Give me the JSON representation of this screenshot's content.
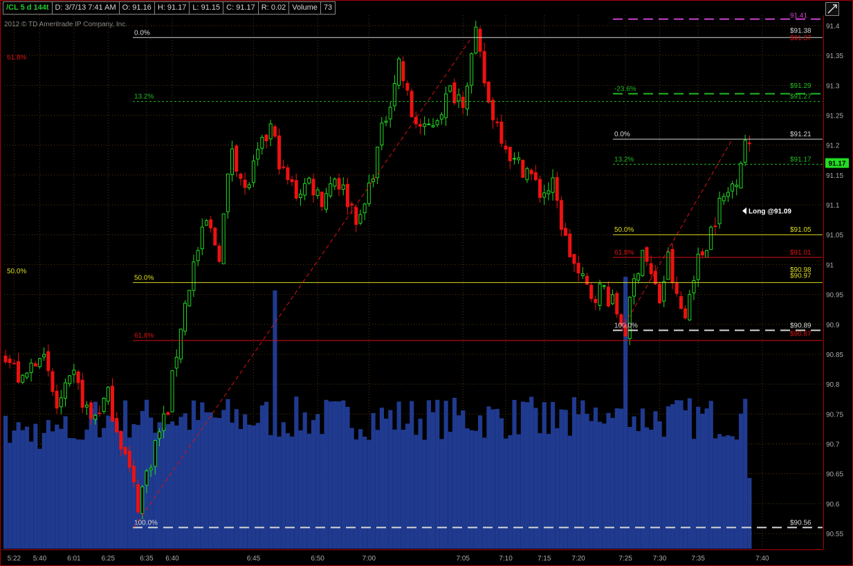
{
  "header": {
    "symbol": "/CL 5 d 144t",
    "datetime": "D: 3/7/13 7:41 AM",
    "open": "O: 91.16",
    "high": "H: 91.17",
    "low": "L: 91.15",
    "close": "C: 91.17",
    "range": "R: 0.02",
    "volume_label": "Volume",
    "volume_value": "73"
  },
  "copyright": "2012 © TD Ameritrade IP Company, Inc.",
  "colors": {
    "background": "#000000",
    "grid": "#5a3a10",
    "bull": "#22dd22",
    "bear": "#ee1111",
    "volume": "#1f3a8f",
    "fib_white": "#d8d8d8",
    "fib_green": "#22bb22",
    "fib_yellow": "#dddd22",
    "fib_red": "#dd1111",
    "fib_magenta": "#cc44cc",
    "axis_text": "#aaaaaa",
    "frame": "#b00000"
  },
  "chart_data": {
    "type": "candlestick",
    "title": "",
    "ylim": [
      90.525,
      91.415
    ],
    "y_ticks": [
      90.55,
      90.6,
      90.65,
      90.7,
      90.75,
      90.8,
      90.85,
      90.9,
      90.95,
      91,
      91.05,
      91.1,
      91.15,
      91.2,
      91.25,
      91.3,
      91.35,
      91.4
    ],
    "y_tick_labels": [
      "90.55",
      "90.6",
      "90.65",
      "90.7",
      "90.75",
      "90.8",
      "90.85",
      "90.9",
      "90.95",
      "91",
      "91.05",
      "91.1",
      "91.15",
      "91.2",
      "91.25",
      "91.3",
      "91.35",
      "91.4"
    ],
    "bar_count": 175,
    "x_tick_labels": [
      {
        "label": "5:22",
        "bar": 2
      },
      {
        "label": "5:40",
        "bar": 8
      },
      {
        "label": "6:01",
        "bar": 16
      },
      {
        "label": "6:25",
        "bar": 24
      },
      {
        "label": "6:35",
        "bar": 33
      },
      {
        "label": "6:40",
        "bar": 39
      },
      {
        "label": "6:45",
        "bar": 58
      },
      {
        "label": "6:50",
        "bar": 73
      },
      {
        "label": "7:00",
        "bar": 85
      },
      {
        "label": "7:05",
        "bar": 107
      },
      {
        "label": "7:10",
        "bar": 117
      },
      {
        "label": "7:15",
        "bar": 126
      },
      {
        "label": "7:20",
        "bar": 134
      },
      {
        "label": "7:25",
        "bar": 145
      },
      {
        "label": "7:30",
        "bar": 153
      },
      {
        "label": "7:35",
        "bar": 162
      },
      {
        "label": "7:40",
        "bar": 177
      }
    ],
    "price_anchors": [
      [
        0,
        90.85
      ],
      [
        4,
        90.8
      ],
      [
        8,
        90.86
      ],
      [
        12,
        90.76
      ],
      [
        16,
        90.81
      ],
      [
        20,
        90.74
      ],
      [
        24,
        90.78
      ],
      [
        28,
        90.68
      ],
      [
        31,
        90.6
      ],
      [
        35,
        90.7
      ],
      [
        38,
        90.76
      ],
      [
        41,
        90.9
      ],
      [
        44,
        91.0
      ],
      [
        47,
        91.07
      ],
      [
        50,
        91.02
      ],
      [
        53,
        91.2
      ],
      [
        56,
        91.12
      ],
      [
        59,
        91.18
      ],
      [
        62,
        91.23
      ],
      [
        65,
        91.15
      ],
      [
        68,
        91.12
      ],
      [
        71,
        91.14
      ],
      [
        74,
        91.11
      ],
      [
        77,
        91.15
      ],
      [
        80,
        91.11
      ],
      [
        83,
        91.07
      ],
      [
        86,
        91.16
      ],
      [
        89,
        91.25
      ],
      [
        92,
        91.34
      ],
      [
        95,
        91.25
      ],
      [
        98,
        91.22
      ],
      [
        101,
        91.25
      ],
      [
        104,
        91.29
      ],
      [
        107,
        91.28
      ],
      [
        110,
        91.38
      ],
      [
        113,
        91.27
      ],
      [
        116,
        91.22
      ],
      [
        119,
        91.17
      ],
      [
        122,
        91.16
      ],
      [
        125,
        91.12
      ],
      [
        128,
        91.13
      ],
      [
        131,
        91.04
      ],
      [
        134,
        90.98
      ],
      [
        137,
        90.95
      ],
      [
        140,
        90.96
      ],
      [
        143,
        90.92
      ],
      [
        145,
        90.89
      ],
      [
        147,
        90.97
      ],
      [
        149,
        91.03
      ],
      [
        151,
        90.98
      ],
      [
        153,
        90.94
      ],
      [
        155,
        91.01
      ],
      [
        157,
        90.94
      ],
      [
        159,
        90.91
      ],
      [
        161,
        90.99
      ],
      [
        163,
        91.02
      ],
      [
        165,
        91.06
      ],
      [
        167,
        91.1
      ],
      [
        169,
        91.12
      ],
      [
        171,
        91.15
      ],
      [
        173,
        91.21
      ],
      [
        175,
        91.17
      ]
    ],
    "volume_peaks": [
      {
        "bar": 63,
        "level": 0.95
      },
      {
        "bar": 145,
        "level": 1.0
      }
    ],
    "fib_series": [
      {
        "name": "",
        "levels": [
          {
            "label": "0.0%",
            "price": 91.38,
            "color": "fib_white",
            "style": "solid",
            "label_side": "left"
          },
          {
            "label": "13.2%",
            "price": 91.273,
            "color": "fib_green",
            "style": "dotted",
            "label_side": "left"
          },
          {
            "label": "50.0%",
            "price": 90.97,
            "color": "fib_yellow",
            "style": "solid",
            "label_side": "left"
          },
          {
            "label": "61.8%",
            "price": 90.873,
            "color": "fib_red",
            "style": "solid",
            "label_side": "left"
          },
          {
            "label": "100.0%",
            "price": 90.56,
            "color": "fib_white",
            "style": "dashed",
            "label_side": "left"
          }
        ],
        "trend_line": {
          "from_bar": 30,
          "from_price": 90.56,
          "to_bar": 109,
          "to_price": 91.38
        }
      },
      {
        "name": "",
        "levels": [
          {
            "label": "-23.6%",
            "price": 91.286,
            "color": "fib_green",
            "style": "dashed",
            "label_side": "left"
          },
          {
            "label": "0.0%",
            "price": 91.21,
            "color": "fib_white",
            "style": "solid",
            "label_side": "left"
          },
          {
            "label": "13.2%",
            "price": 91.168,
            "color": "fib_green",
            "style": "dotted",
            "label_side": "left"
          },
          {
            "label": "50.0%",
            "price": 91.05,
            "color": "fib_yellow",
            "style": "solid",
            "label_side": "left"
          },
          {
            "label": "61.8%",
            "price": 91.012,
            "color": "fib_red",
            "style": "solid",
            "label_side": "left"
          },
          {
            "label": "100.0%",
            "price": 90.89,
            "color": "fib_white",
            "style": "dashed",
            "label_side": "left"
          }
        ],
        "trend_line": {
          "from_bar": 144,
          "from_price": 90.89,
          "to_bar": 170,
          "to_price": 91.21
        }
      }
    ],
    "edge_labels": [
      {
        "label": "61.8%",
        "price": 91.348,
        "color": "fib_red"
      },
      {
        "label": "50.0%",
        "price": 90.99,
        "color": "fib_yellow"
      }
    ],
    "price_labels": [
      {
        "label": "$91.38",
        "price": 91.383,
        "color": "fib_white"
      },
      {
        "label": "$91.37",
        "price": 91.371,
        "color": "fib_red"
      },
      {
        "label": "$91.29",
        "price": 91.291,
        "color": "fib_green"
      },
      {
        "label": "$91.27",
        "price": 91.273,
        "color": "fib_green"
      },
      {
        "label": "$91.21",
        "price": 91.21,
        "color": "fib_white"
      },
      {
        "label": "$91.17",
        "price": 91.168,
        "color": "fib_green"
      },
      {
        "label": "$91.05",
        "price": 91.05,
        "color": "fib_yellow"
      },
      {
        "label": "$91.01",
        "price": 91.012,
        "color": "fib_red"
      },
      {
        "label": "$90.98",
        "price": 90.983,
        "color": "fib_yellow"
      },
      {
        "label": "$90.97",
        "price": 90.973,
        "color": "fib_yellow"
      },
      {
        "label": "$90.89",
        "price": 90.89,
        "color": "fib_white"
      },
      {
        "label": "$90.87",
        "price": 90.876,
        "color": "fib_red"
      },
      {
        "label": "$90.56",
        "price": 90.56,
        "color": "fib_white"
      }
    ],
    "partial_top_line": {
      "label": "91.41",
      "price": 91.405,
      "color": "fib_magenta"
    },
    "last_price": {
      "label": "91.17",
      "price": 91.17
    },
    "annotation": {
      "label": "Long @91.09",
      "price": 91.09,
      "bar": 171
    }
  }
}
